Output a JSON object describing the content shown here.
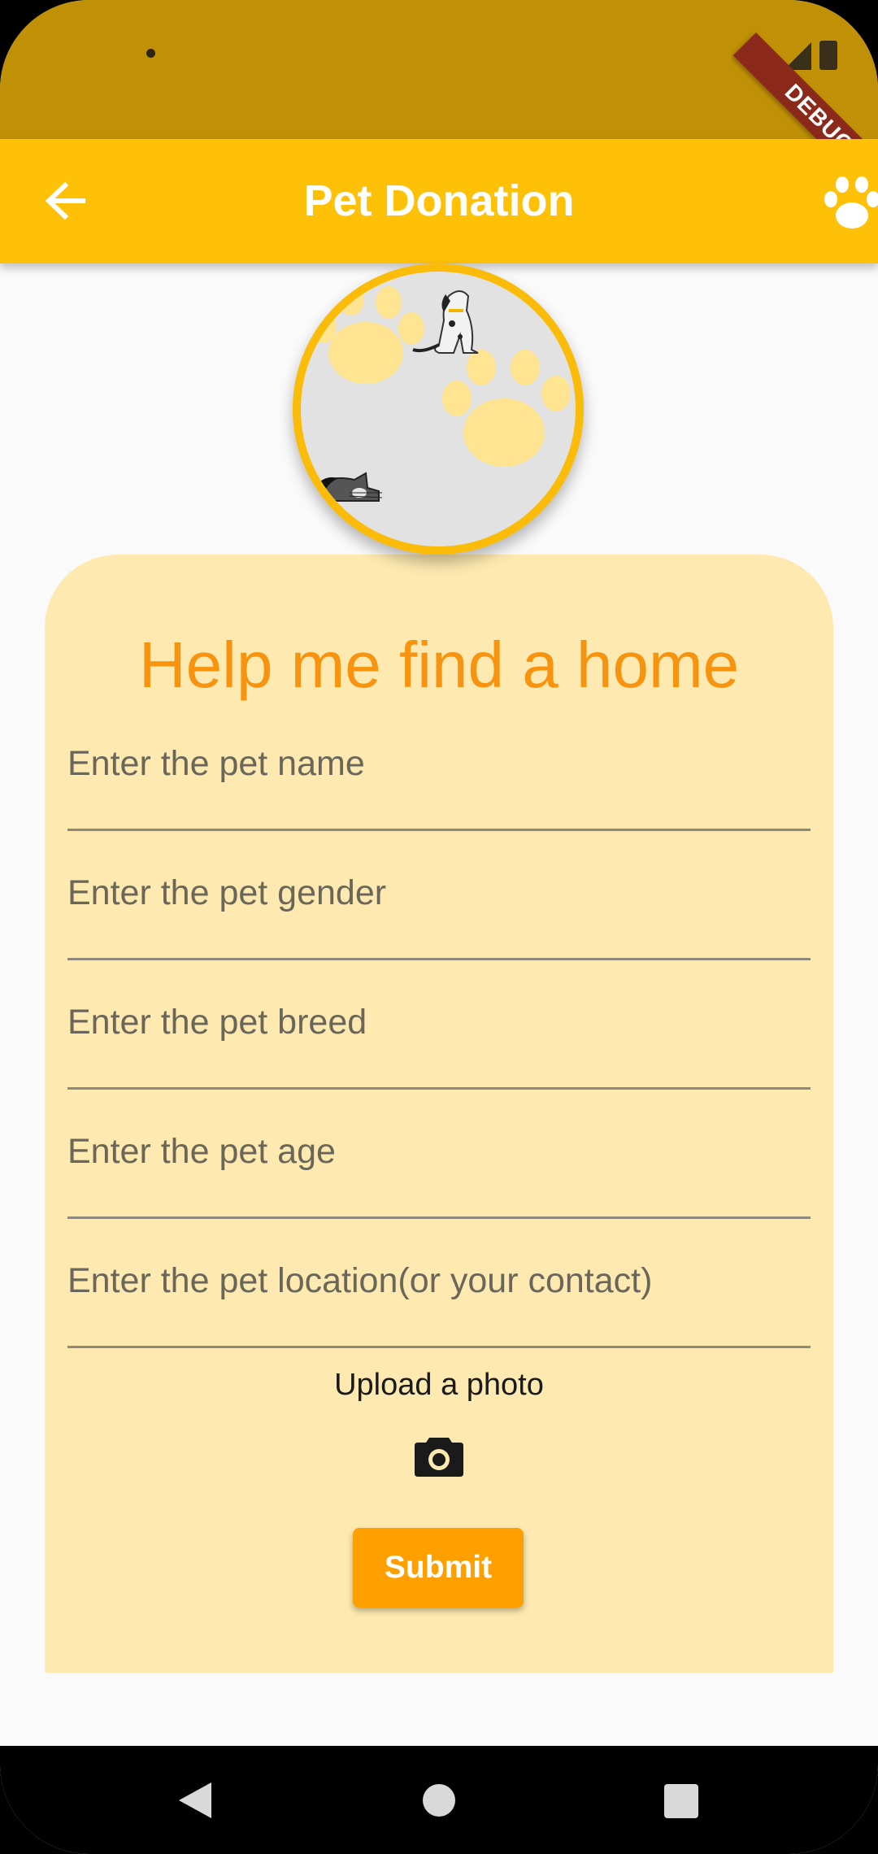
{
  "status_bar": {
    "debug_label": "DEBUG",
    "icons": [
      "camera-dot",
      "signal-icon"
    ]
  },
  "app_bar": {
    "title": "Pet Donation",
    "back_icon": "arrow-back-icon",
    "action_icon": "paw-icon"
  },
  "avatar": {
    "description_icons": [
      "paw-print",
      "dog",
      "cat"
    ]
  },
  "form": {
    "heading": "Help me find a home",
    "fields": [
      {
        "placeholder": "Enter the pet name",
        "value": ""
      },
      {
        "placeholder": "Enter the pet gender",
        "value": ""
      },
      {
        "placeholder": "Enter the pet breed",
        "value": ""
      },
      {
        "placeholder": "Enter the pet age",
        "value": ""
      },
      {
        "placeholder": "Enter the pet location(or your contact)",
        "value": ""
      }
    ],
    "upload_label": "Upload a photo",
    "upload_icon": "camera-icon",
    "submit_label": "Submit"
  },
  "nav_bar": {
    "icons": [
      "back-triangle-icon",
      "home-circle-icon",
      "recents-square-icon"
    ]
  },
  "colors": {
    "status_bar": "#c09106",
    "app_bar": "#ffc107",
    "card": "#feeab0",
    "heading": "#f7930e",
    "submit": "#ffa000",
    "avatar_border": "#fbbc09"
  }
}
